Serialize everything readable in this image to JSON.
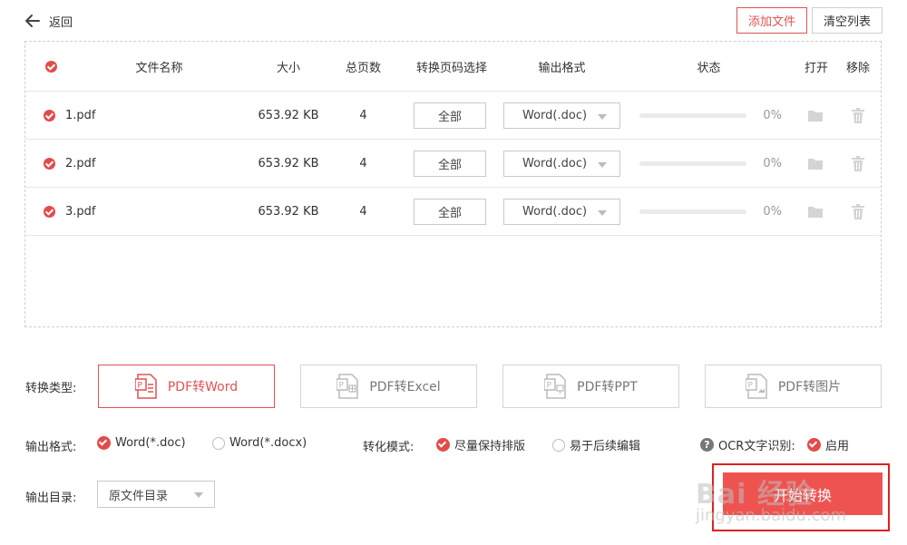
{
  "header": {
    "back_label": "返回",
    "add_files_label": "添加文件",
    "clear_list_label": "清空列表"
  },
  "table": {
    "columns": {
      "name": "文件名称",
      "size": "大小",
      "pages": "总页数",
      "page_select": "转换页码选择",
      "format": "输出格式",
      "status": "状态",
      "open": "打开",
      "remove": "移除"
    },
    "rows": [
      {
        "name": "1.pdf",
        "size": "653.92 KB",
        "pages": "4",
        "page_select": "全部",
        "format": "Word(.doc)",
        "progress": 0,
        "status_pct": "0%"
      },
      {
        "name": "2.pdf",
        "size": "653.92 KB",
        "pages": "4",
        "page_select": "全部",
        "format": "Word(.doc)",
        "progress": 0,
        "status_pct": "0%"
      },
      {
        "name": "3.pdf",
        "size": "653.92 KB",
        "pages": "4",
        "page_select": "全部",
        "format": "Word(.doc)",
        "progress": 0,
        "status_pct": "0%"
      }
    ]
  },
  "options": {
    "type_label": "转换类型:",
    "types": [
      {
        "label": "PDF转Word",
        "active": true
      },
      {
        "label": "PDF转Excel",
        "active": false
      },
      {
        "label": "PDF转PPT",
        "active": false
      },
      {
        "label": "PDF转图片",
        "active": false
      }
    ],
    "format_label": "输出格式:",
    "format_options": [
      {
        "label": "Word(*.doc)",
        "selected": true
      },
      {
        "label": "Word(*.docx)",
        "selected": false
      }
    ],
    "mode_label": "转化模式:",
    "mode_options": [
      {
        "label": "尽量保持排版",
        "selected": true
      },
      {
        "label": "易于后续编辑",
        "selected": false
      }
    ],
    "ocr_label": "OCR文字识别:",
    "ocr_option": "启用",
    "dir_label": "输出目录:",
    "dir_value": "原文件目录"
  },
  "start_button": "开始转换",
  "watermark": {
    "main": "Bai 经验",
    "sub": "jingyan.baidu.com"
  },
  "colors": {
    "accent": "#e34b4b",
    "start_button": "#ef5350",
    "highlight_outline": "#e02020"
  },
  "icons": [
    "back-arrow-icon",
    "check-icon",
    "folder-icon",
    "trash-icon",
    "pdf-doc-icon",
    "help-icon",
    "chevron-down-icon"
  ]
}
